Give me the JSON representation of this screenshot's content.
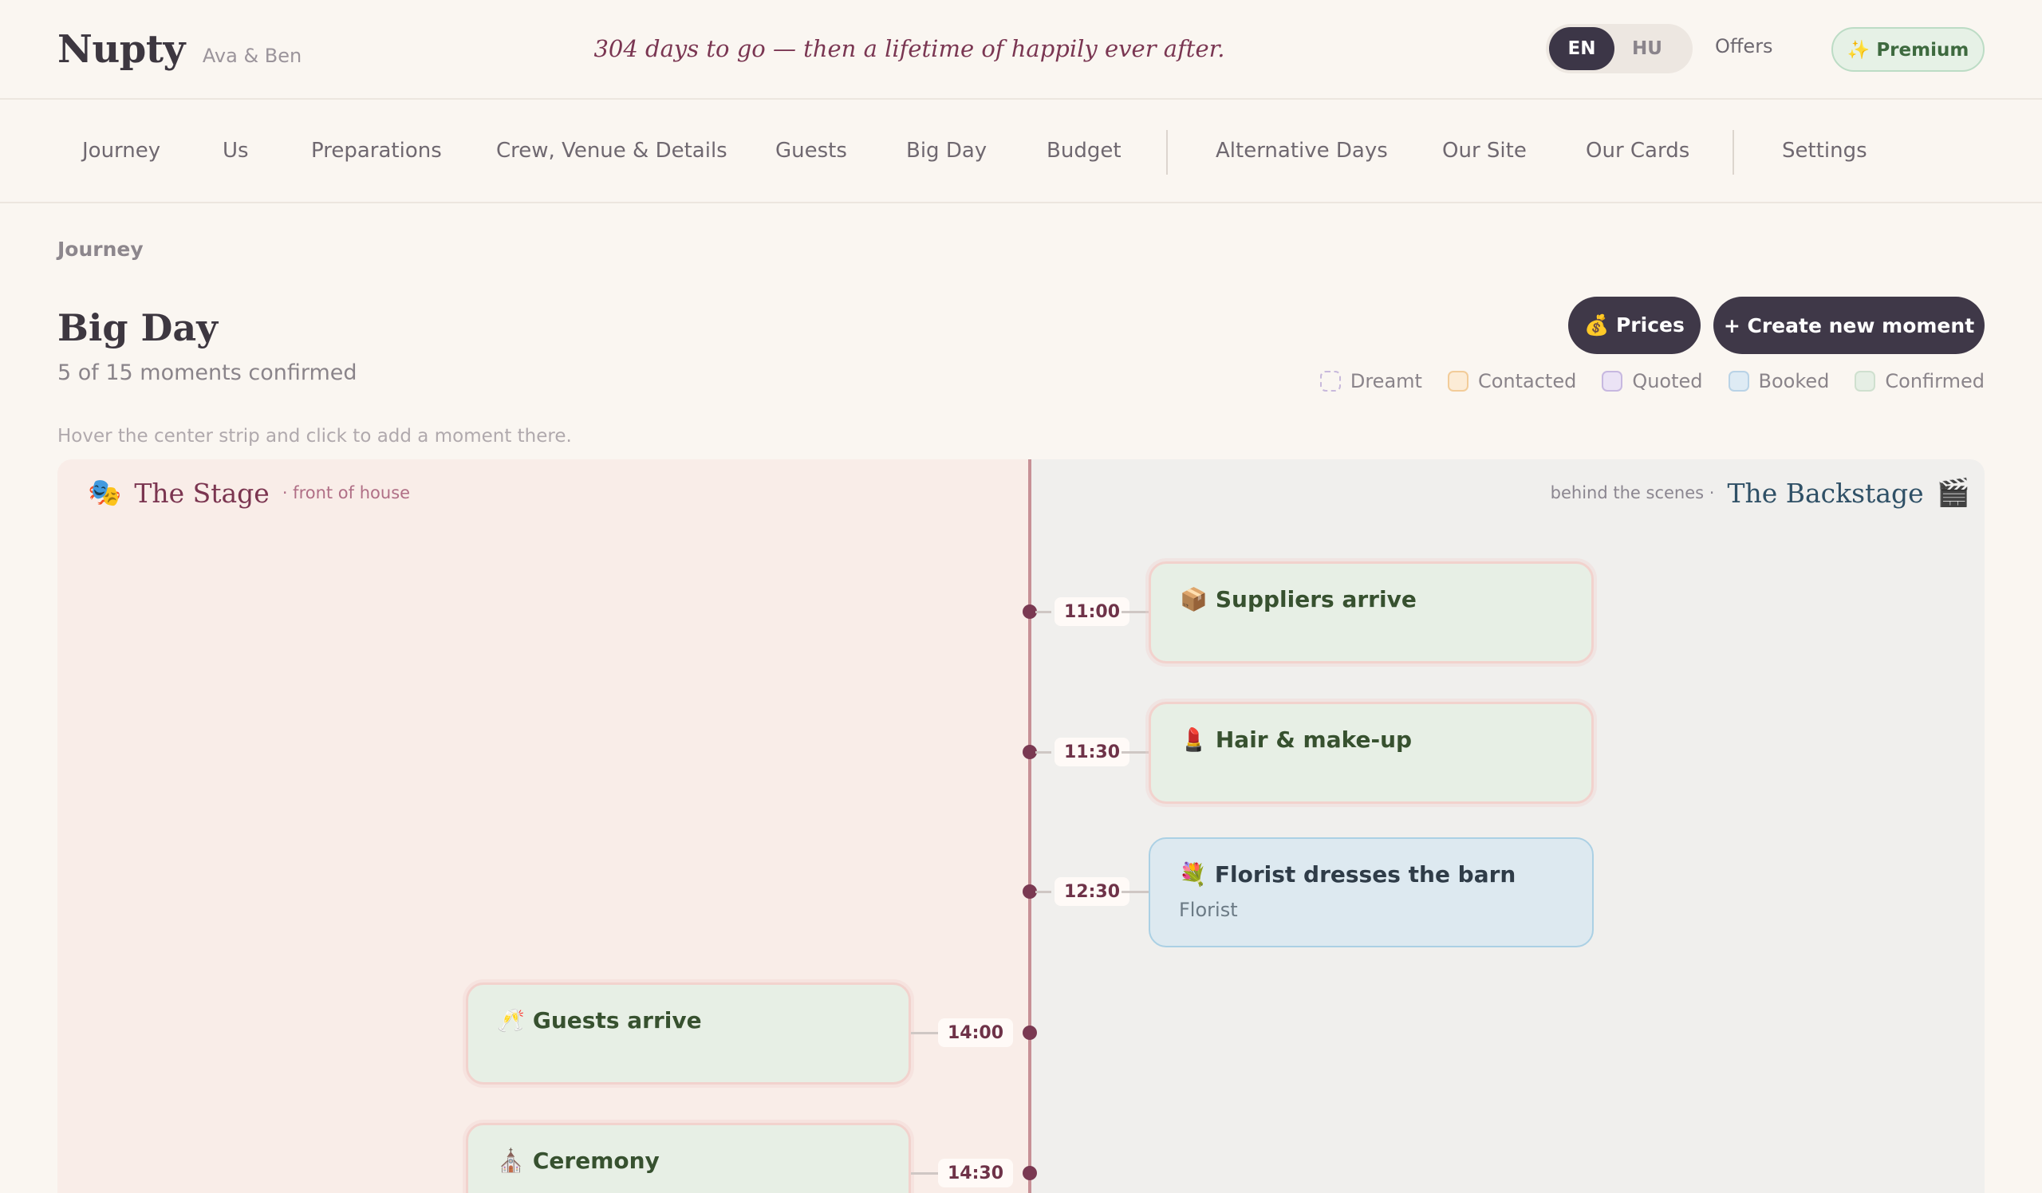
{
  "header": {
    "brand": "Nupty",
    "couple": "Ava & Ben",
    "tagline": "304 days to go — then a lifetime of happily ever after.",
    "languages": [
      {
        "label": "EN",
        "active": true
      },
      {
        "label": "HU",
        "active": false
      }
    ],
    "offers_label": "Offers",
    "premium_label": "✨ Premium"
  },
  "nav": {
    "items": [
      "Journey",
      "Us",
      "Preparations",
      "Crew, Venue & Details",
      "Guests",
      "Big Day",
      "Budget",
      "Alternative Days",
      "Our Site",
      "Our Cards",
      "Settings"
    ]
  },
  "breadcrumb": "Journey",
  "page": {
    "title": "Big Day",
    "subtitle": "5 of 15 moments confirmed",
    "prices_label": "💰 Prices",
    "create_label": "+ Create new moment",
    "hint": "Hover the center strip and click to add a moment there."
  },
  "legend": [
    {
      "label": "Dreamt",
      "color": "#c8b9dc",
      "fill": "#faf6f1",
      "dashed": true
    },
    {
      "label": "Contacted",
      "color": "#f2cc99",
      "fill": "#fcecd6"
    },
    {
      "label": "Quoted",
      "color": "#c7b8e0",
      "fill": "#ebe3f5"
    },
    {
      "label": "Booked",
      "color": "#b9d3e6",
      "fill": "#deebf4"
    },
    {
      "label": "Confirmed",
      "color": "#cfe0cf",
      "fill": "#e6efe5"
    }
  ],
  "board": {
    "stage": {
      "icon": "🎭",
      "title": "The Stage",
      "subtitle": "· front of house"
    },
    "backstage": {
      "icon": "🎬",
      "title": "The Backstage",
      "subtitle": "behind the scenes ·"
    },
    "moments": [
      {
        "time": "11:00",
        "side": "backstage",
        "icon": "📦",
        "title": "Suppliers arrive",
        "status": "confirmed",
        "supplier": ""
      },
      {
        "time": "11:30",
        "side": "backstage",
        "icon": "💄",
        "title": "Hair & make-up",
        "status": "confirmed",
        "supplier": ""
      },
      {
        "time": "12:30",
        "side": "backstage",
        "icon": "💐",
        "title": "Florist dresses the barn",
        "status": "booked",
        "supplier": "Florist"
      },
      {
        "time": "14:00",
        "side": "stage",
        "icon": "🥂",
        "title": "Guests arrive",
        "status": "confirmed",
        "supplier": ""
      },
      {
        "time": "14:30",
        "side": "stage",
        "icon": "⛪",
        "title": "Ceremony",
        "status": "confirmed",
        "supplier": ""
      }
    ]
  }
}
